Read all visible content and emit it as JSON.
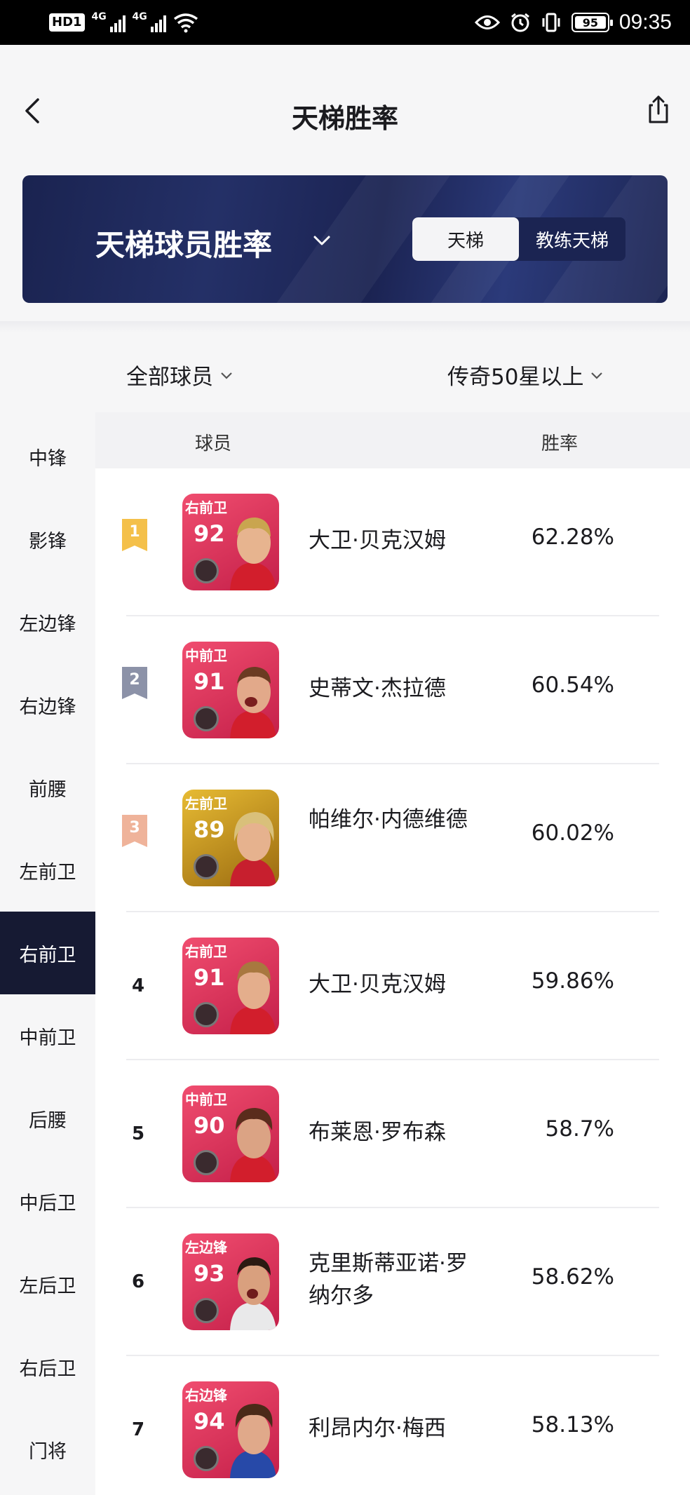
{
  "status_bar": {
    "hd": "HD",
    "sim1": "1",
    "net1": "4G",
    "net2": "4G",
    "battery": "95",
    "battery_level": 0.95,
    "time": "09:35"
  },
  "header": {
    "title": "天梯胜率"
  },
  "banner": {
    "title": "天梯球员胜率",
    "toggle": [
      "天梯",
      "教练天梯"
    ],
    "toggle_active": 0
  },
  "filters": {
    "player_filter": "全部球员",
    "tier_filter": "传奇50星以上"
  },
  "sidebar": {
    "items": [
      "中锋",
      "影锋",
      "左边锋",
      "右边锋",
      "前腰",
      "左前卫",
      "右前卫",
      "中前卫",
      "后腰",
      "中后卫",
      "左后卫",
      "右后卫",
      "门将"
    ],
    "active_index": 6
  },
  "table": {
    "col_player": "球员",
    "col_rate": "胜率",
    "rows": [
      {
        "rank": "1",
        "position": "右前卫",
        "rating": "92",
        "name": "大卫·贝克汉姆",
        "rate": "62.28%",
        "card_color": "#e0335a"
      },
      {
        "rank": "2",
        "position": "中前卫",
        "rating": "91",
        "name": "史蒂文·杰拉德",
        "rate": "60.54%",
        "card_color": "#e0335a"
      },
      {
        "rank": "3",
        "position": "左前卫",
        "rating": "89",
        "name": "帕维尔·内德维德",
        "rate": "60.02%",
        "card_color": "#c9961c"
      },
      {
        "rank": "4",
        "position": "右前卫",
        "rating": "91",
        "name": "大卫·贝克汉姆",
        "rate": "59.86%",
        "card_color": "#e0335a"
      },
      {
        "rank": "5",
        "position": "中前卫",
        "rating": "90",
        "name": "布莱恩·罗布森",
        "rate": "58.7%",
        "card_color": "#e0335a"
      },
      {
        "rank": "6",
        "position": "左边锋",
        "rating": "93",
        "name": "克里斯蒂亚诺·罗纳尔多",
        "rate": "58.62%",
        "card_color": "#e0335a"
      },
      {
        "rank": "7",
        "position": "右边锋",
        "rating": "94",
        "name": "利昂内尔·梅西",
        "rate": "58.13%",
        "card_color": "#e0335a"
      }
    ]
  },
  "colors": {
    "accent_dark": "#161a33",
    "banner_bg": "#1a2350",
    "gold_ribbon": "#f4c04a",
    "silver_ribbon": "#8c92a8",
    "bronze_ribbon": "#efb39a"
  },
  "icons": {
    "back": "chevron-left-icon",
    "share": "share-icon",
    "dropdown": "chevron-down-icon"
  }
}
